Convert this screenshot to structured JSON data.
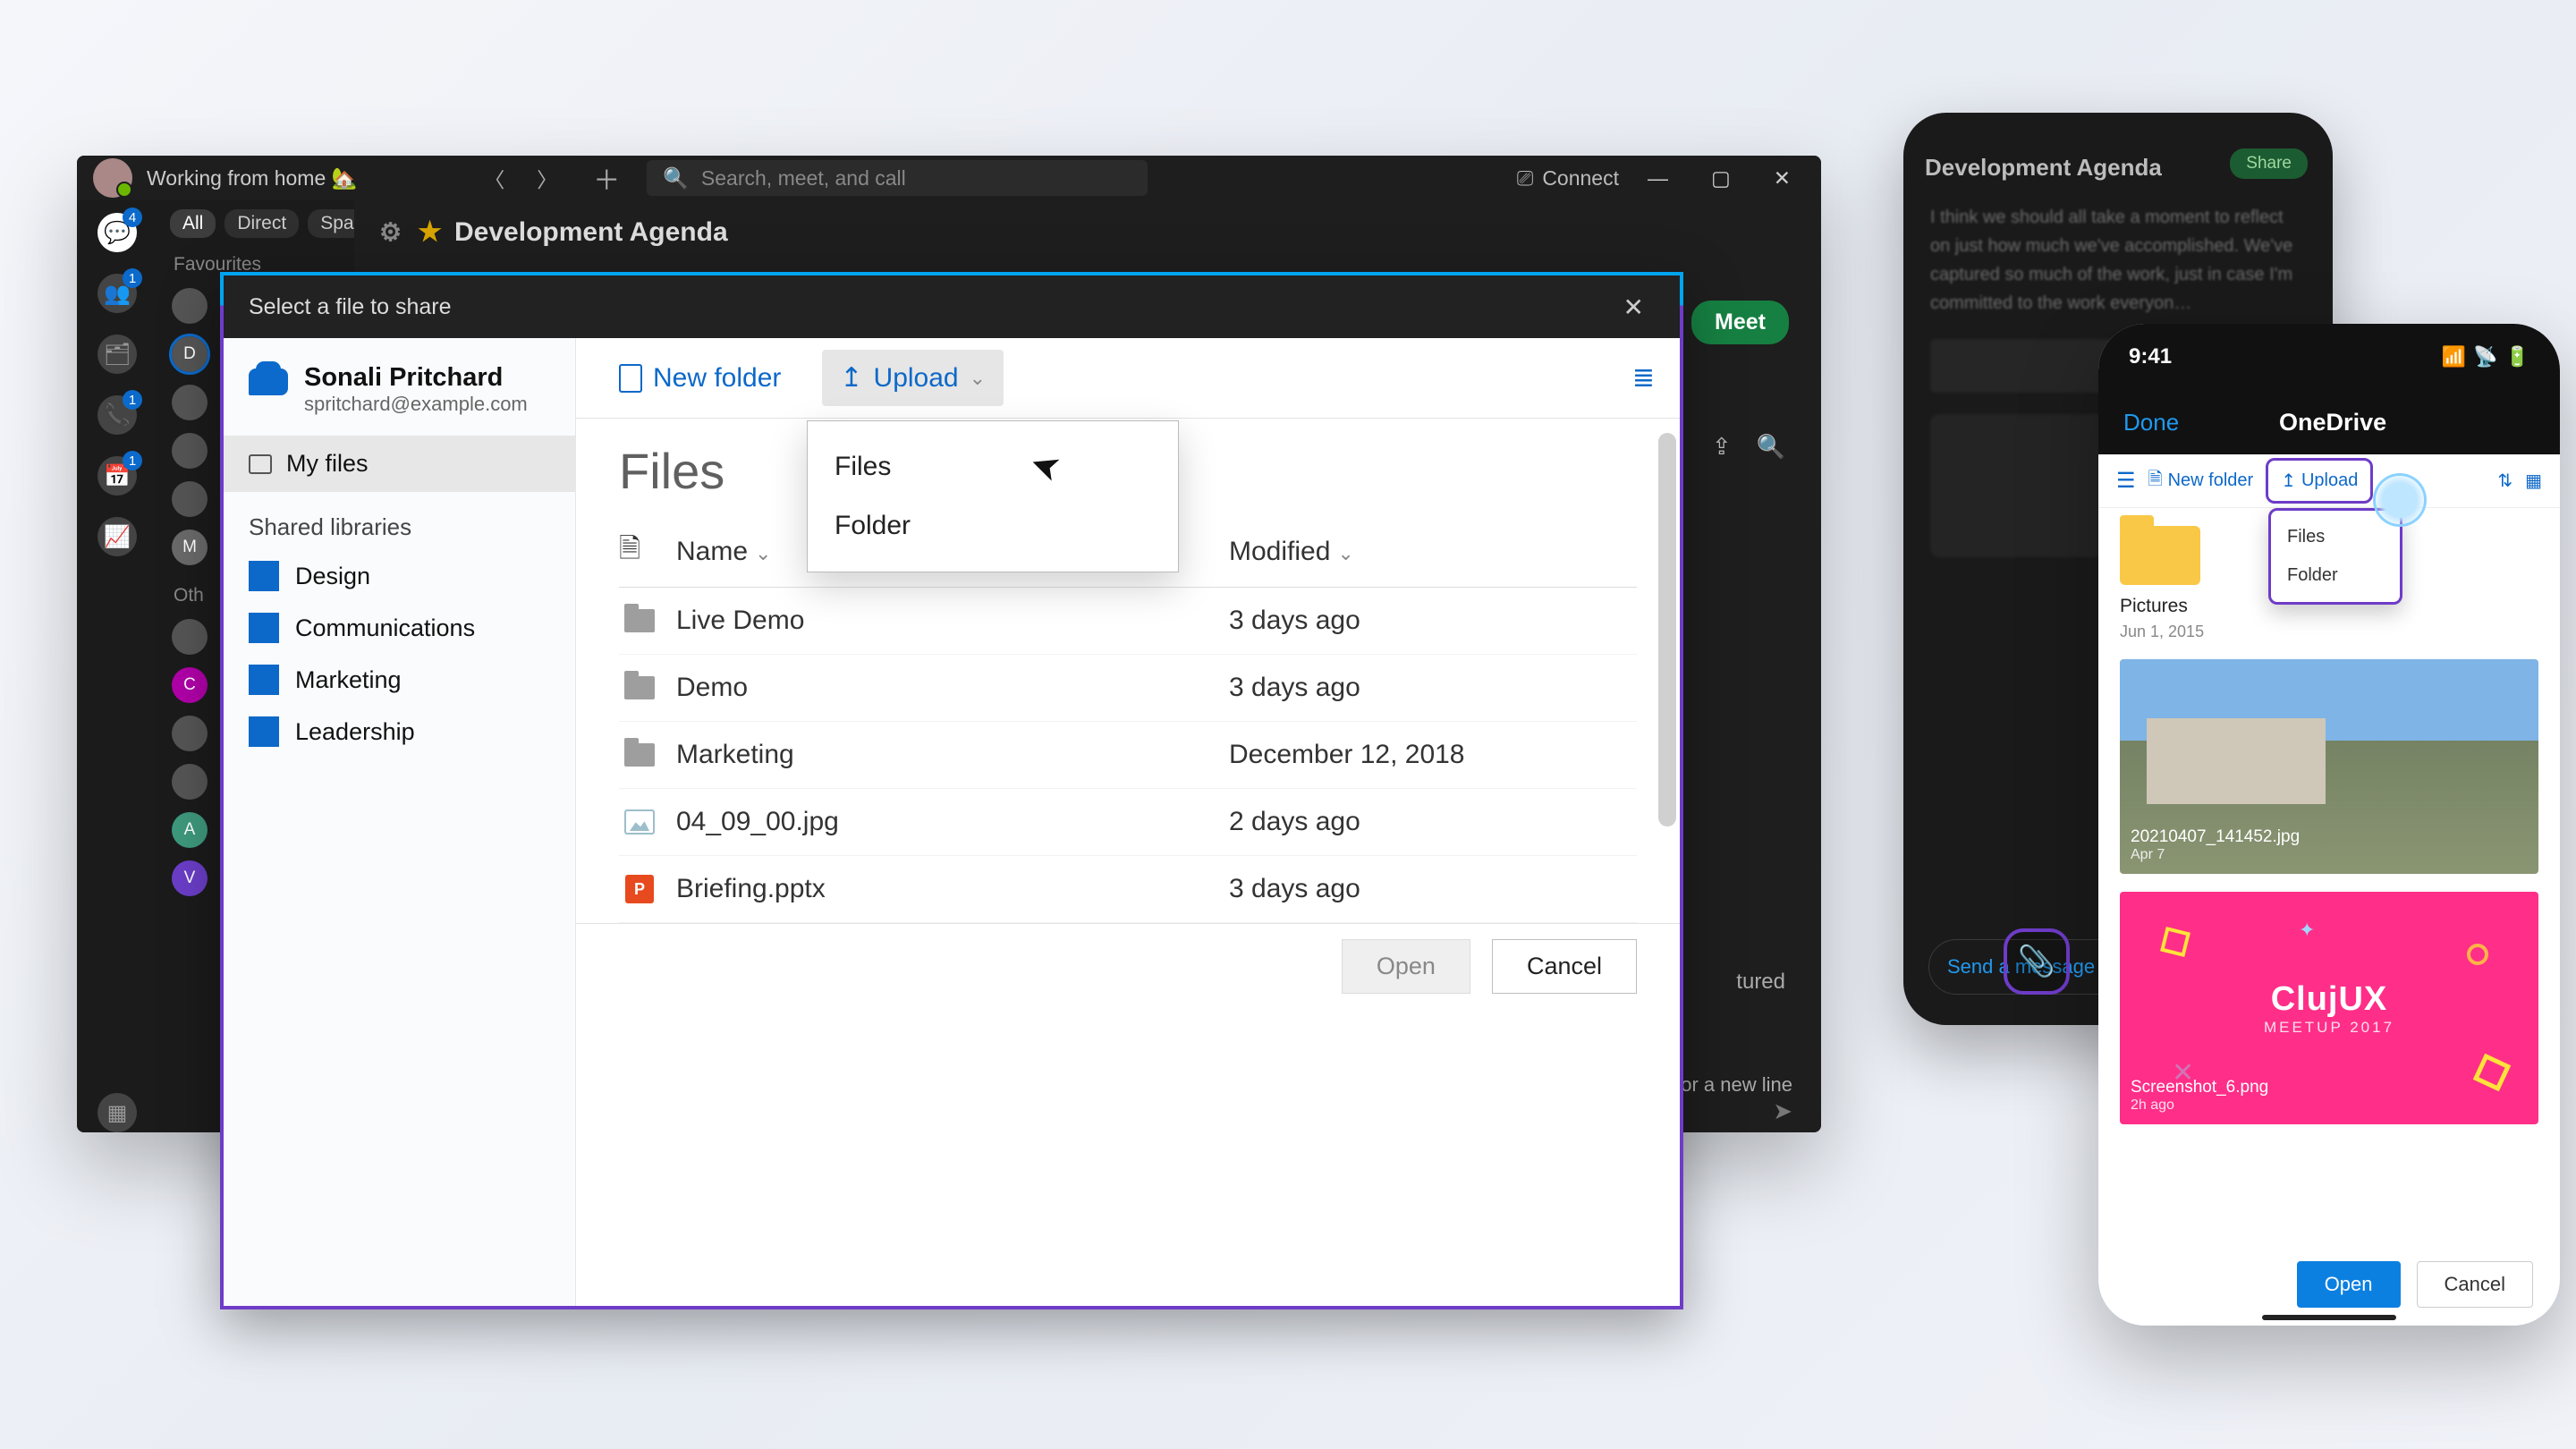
{
  "app": {
    "status_text": "Working from home 🏡",
    "search_placeholder": "Search, meet, and call",
    "connect_label": "Connect",
    "tabs": {
      "all": "All",
      "direct": "Direct",
      "spaces": "Spaces",
      "favourites": "Favourites",
      "other": "Oth"
    },
    "thread_title": "Development Agenda",
    "meet": "Meet",
    "featured_peek": "tured",
    "hint_peek": "or a new line",
    "rail_contacts": [
      "D",
      "",
      "",
      "",
      "",
      "M",
      "",
      "",
      "",
      "",
      "A",
      "V"
    ]
  },
  "modal": {
    "title": "Select a file to share",
    "account": {
      "name": "Sonali Pritchard",
      "email": "spritchard@example.com"
    },
    "my_files": "My files",
    "shared_header": "Shared libraries",
    "libraries": [
      "Design",
      "Communications",
      "Marketing",
      "Leadership"
    ],
    "toolbar": {
      "new_folder": "New folder",
      "upload": "Upload"
    },
    "upload_menu": {
      "files": "Files",
      "folder": "Folder"
    },
    "files_heading": "Files",
    "columns": {
      "name": "Name",
      "modified": "Modified"
    },
    "rows": [
      {
        "icon": "folder",
        "name": "Live Demo",
        "modified": "3 days ago"
      },
      {
        "icon": "folder",
        "name": "Demo",
        "modified": "3 days ago"
      },
      {
        "icon": "folder",
        "name": "Marketing",
        "modified": "December 12, 2018"
      },
      {
        "icon": "image",
        "name": "04_09_00.jpg",
        "modified": "2 days ago"
      },
      {
        "icon": "pptx",
        "name": "Briefing.pptx",
        "modified": "3 days ago"
      }
    ],
    "footer": {
      "open": "Open",
      "cancel": "Cancel"
    }
  },
  "phone_dark": {
    "title": "Development Agenda",
    "share": "Share",
    "msg": "I think we should all take a moment to reflect on just how much we've accomplished. We've captured so much of the work, just in case I'm committed to the work everyon…",
    "input_placeholder": "Send a message"
  },
  "phone_light": {
    "time": "9:41",
    "done": "Done",
    "title": "OneDrive",
    "toolbar": {
      "new_folder": "New folder",
      "upload": "Upload"
    },
    "menu": {
      "files": "Files",
      "folder": "Folder"
    },
    "items": [
      {
        "name": "Pictures",
        "date": "Jun 1, 2015"
      },
      {
        "name": "20210407_141452.jpg",
        "date": "Apr 7"
      },
      {
        "name": "Screenshot_6.png",
        "date": "2h ago"
      }
    ],
    "pink": {
      "logo": "ClujUX",
      "sub": "MEETUP 2017"
    },
    "footer": {
      "open": "Open",
      "cancel": "Cancel"
    }
  }
}
